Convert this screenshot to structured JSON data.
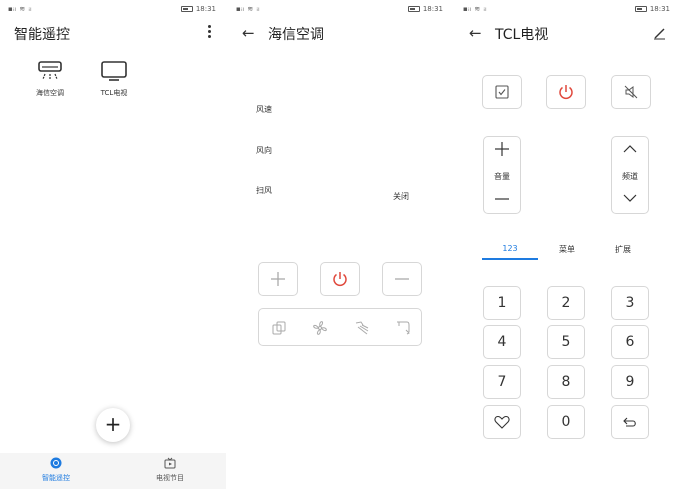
{
  "status": {
    "time": "18:31"
  },
  "home": {
    "title": "智能遥控",
    "devices": [
      {
        "label": "海信空调",
        "icon": "air-conditioner-icon"
      },
      {
        "label": "TCL电视",
        "icon": "tv-icon"
      }
    ],
    "fab_label": "+",
    "nav": [
      {
        "label": "智能遥控",
        "icon": "remote-control-icon",
        "active": true
      },
      {
        "label": "电视节目",
        "icon": "tv-program-icon",
        "active": false
      }
    ]
  },
  "ac": {
    "title": "海信空调",
    "rows": [
      {
        "label": "风速",
        "value": ""
      },
      {
        "label": "风向",
        "value": ""
      },
      {
        "label": "扫风",
        "value": "关闭"
      }
    ],
    "mode_icons": [
      "mode-icon",
      "fan-icon",
      "swing-icon",
      "wind-direction-icon"
    ]
  },
  "tv": {
    "title": "TCL电视",
    "volume_label": "音量",
    "channel_label": "频道",
    "tabs": [
      "123",
      "菜单",
      "扩展"
    ],
    "active_tab": "123",
    "keys": [
      "1",
      "2",
      "3",
      "4",
      "5",
      "6",
      "7",
      "8",
      "9",
      "♡",
      "0",
      "⮌"
    ]
  },
  "colors": {
    "accent": "#1e7be0",
    "power": "#e0483c",
    "border": "#d7d7d7"
  }
}
